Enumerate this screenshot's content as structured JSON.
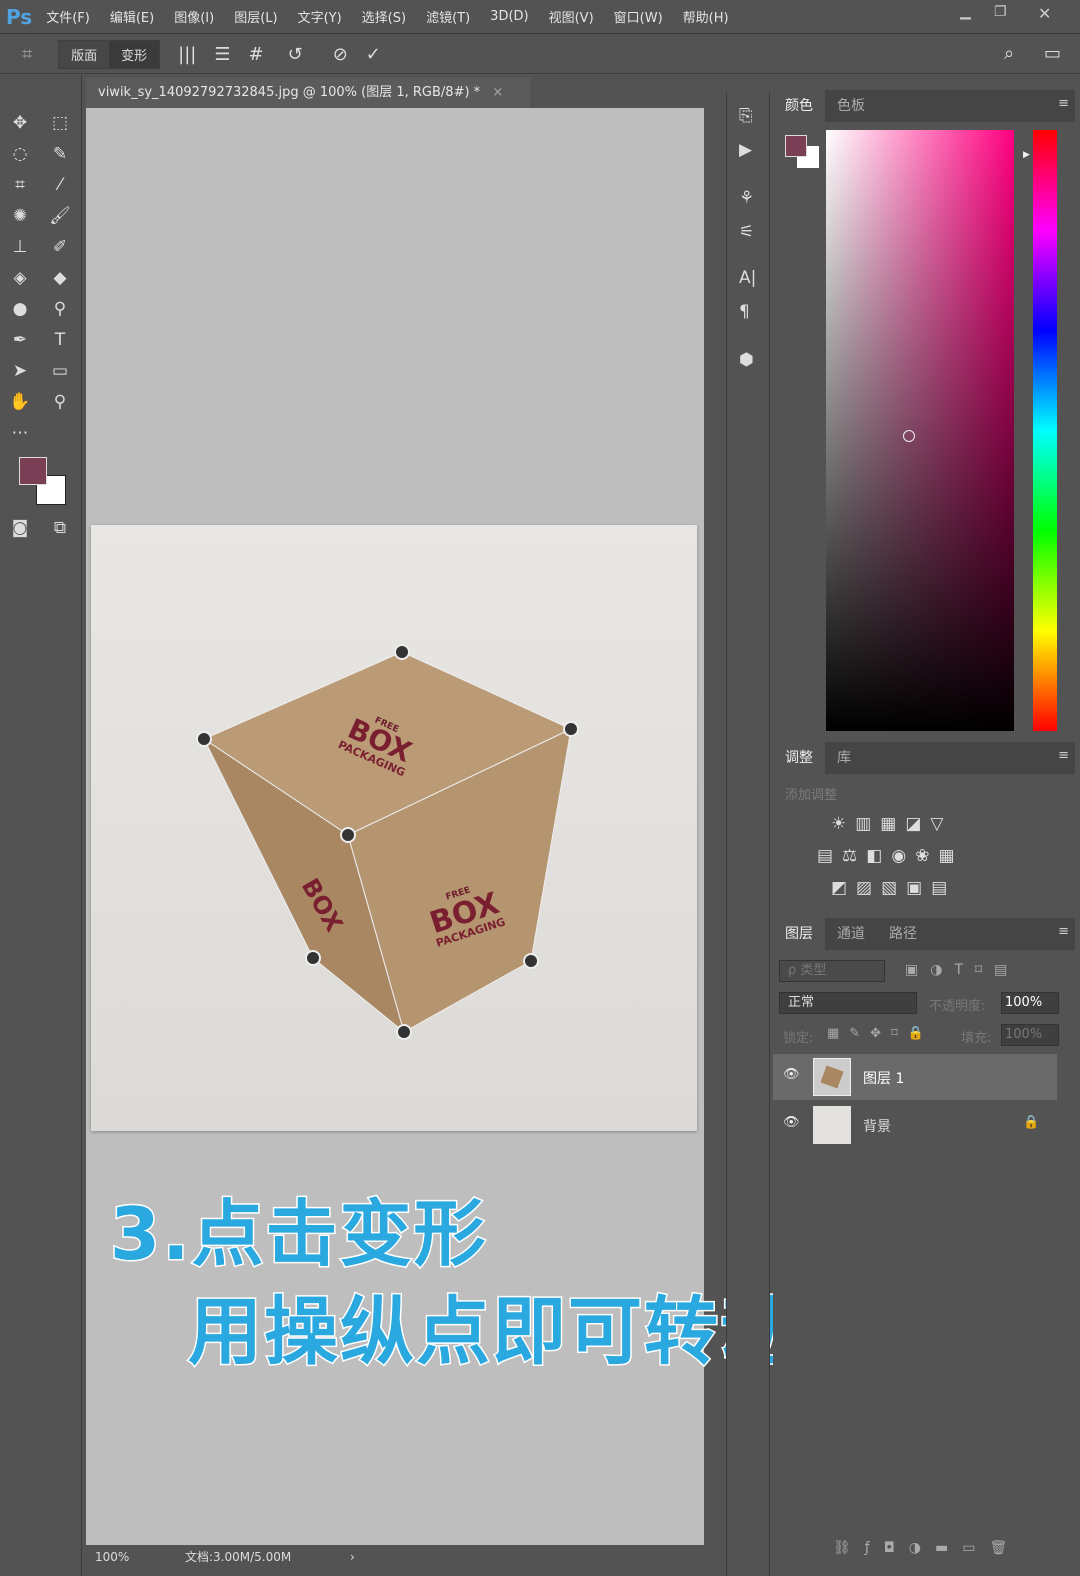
{
  "app": {
    "logo": "Ps"
  },
  "menu": [
    "文件(F)",
    "编辑(E)",
    "图像(I)",
    "图层(L)",
    "文字(Y)",
    "选择(S)",
    "滤镜(T)",
    "3D(D)",
    "视图(V)",
    "窗口(W)",
    "帮助(H)"
  ],
  "options": {
    "mode_buttons": [
      "版面",
      "变形"
    ],
    "active_mode": "变形"
  },
  "document": {
    "tab_title": "viwik_sy_14092792732845.jpg @ 100% (图层 1, RGB/8#) *",
    "close": "×"
  },
  "image": {
    "box_label_top": "BOX",
    "box_label_sub": "PACKAGING",
    "box_label_free": "FREE"
  },
  "caption": {
    "line1": "3.点击变形",
    "line2": "用操纵点即可转动箱子"
  },
  "status": {
    "zoom": "100%",
    "doc": "文档:3.00M/5.00M",
    "arrow": "›"
  },
  "colors": {
    "foreground": "#7a3f55",
    "background": "#ffffff",
    "caption": "#29a9e0"
  },
  "color_panel": {
    "tabs": [
      "颜色",
      "色板"
    ]
  },
  "adjust_panel": {
    "tabs": [
      "调整",
      "库"
    ],
    "hint": "添加调整"
  },
  "layers_panel": {
    "tabs": [
      "图层",
      "通道",
      "路径"
    ],
    "filter_placeholder": "ρ 类型",
    "blend_mode": "正常",
    "opacity_label": "不透明度:",
    "opacity": "100%",
    "lock_label": "锁定:",
    "fill_label": "填充:",
    "fill": "100%",
    "layers": [
      {
        "name": "图层 1",
        "selected": true
      },
      {
        "name": "背景",
        "locked": true
      }
    ]
  }
}
